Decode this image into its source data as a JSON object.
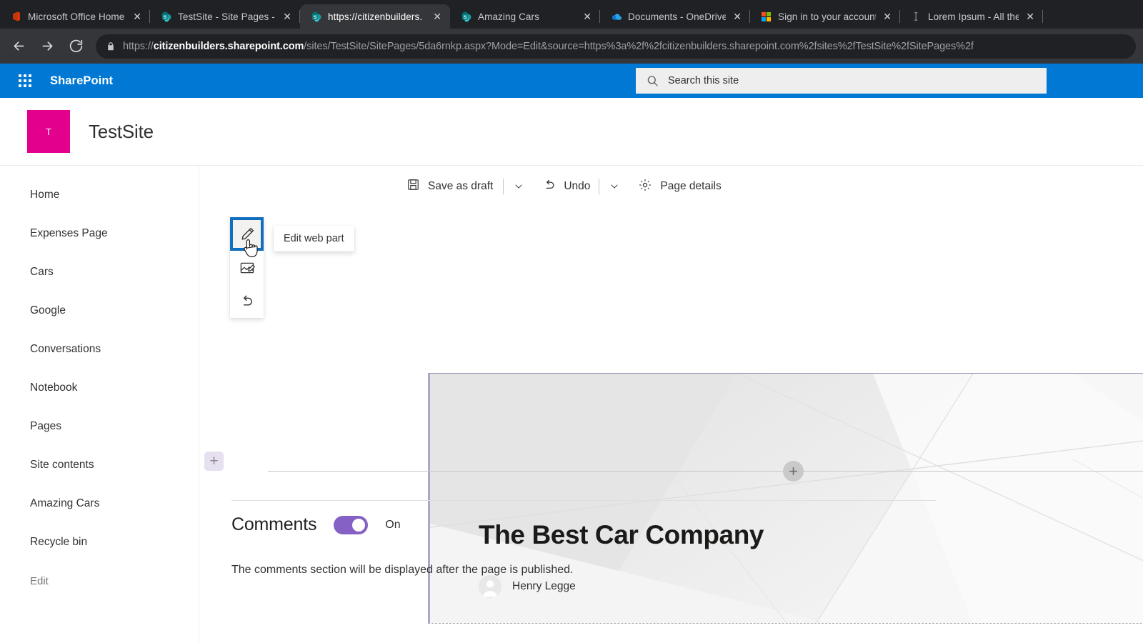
{
  "browser": {
    "tabs": [
      {
        "title": "Microsoft Office Home",
        "icon": "office-icon",
        "active": false,
        "close_label": "✕"
      },
      {
        "title": "TestSite - Site Pages -",
        "icon": "sharepoint-icon",
        "active": false,
        "close_label": "✕"
      },
      {
        "title": "https://citizenbuilders.",
        "icon": "sharepoint-icon",
        "active": true,
        "close_label": "✕"
      },
      {
        "title": "Amazing Cars",
        "icon": "sharepoint-icon",
        "active": false,
        "close_label": "✕"
      },
      {
        "title": "Documents - OneDrive",
        "icon": "onedrive-icon",
        "active": false,
        "close_label": "✕"
      },
      {
        "title": "Sign in to your account",
        "icon": "microsoft-icon",
        "active": false,
        "close_label": "✕"
      },
      {
        "title": "Lorem Ipsum - All the",
        "icon": "generic-icon",
        "active": false,
        "close_label": "✕"
      }
    ],
    "nav": {
      "back_label": "←",
      "forward_label": "→",
      "reload_label": "↻"
    },
    "url": {
      "scheme": "https://",
      "host": "citizenbuilders.sharepoint.com",
      "path": "/sites/TestSite/SitePages/5da6rnkp.aspx?Mode=Edit&source=https%3a%2f%2fcitizenbuilders.sharepoint.com%2fsites%2fTestSite%2fSitePages%2f"
    }
  },
  "suitebar": {
    "brand": "SharePoint",
    "waffle_label": "app-launcher"
  },
  "search": {
    "placeholder": "Search this site",
    "value": "Search this site"
  },
  "site": {
    "logo_letter": "T",
    "title": "TestSite"
  },
  "nav": {
    "items": [
      {
        "label": "Home"
      },
      {
        "label": "Expenses Page"
      },
      {
        "label": "Cars"
      },
      {
        "label": "Google"
      },
      {
        "label": "Conversations"
      },
      {
        "label": "Notebook"
      },
      {
        "label": "Pages"
      },
      {
        "label": "Site contents"
      },
      {
        "label": "Amazing Cars"
      },
      {
        "label": "Recycle bin"
      }
    ],
    "edit_label": "Edit"
  },
  "commandbar": {
    "save_label": "Save as draft",
    "save_chevron": "⌄",
    "undo_label": "Undo",
    "undo_chevron": "⌄",
    "page_details_label": "Page details"
  },
  "webpart_toolbar": {
    "edit_label": "edit-pencil",
    "image_label": "edit-image",
    "undo_label": "undo-arrow",
    "tooltip": "Edit web part"
  },
  "hero": {
    "title": "The Best Car Company",
    "author": "Henry Legge"
  },
  "canvas": {
    "add_section_label": "+",
    "add_webpart_label": "+"
  },
  "comments": {
    "label": "Comments",
    "toggle_state": "On",
    "note": "The comments section will be displayed after the page is published."
  },
  "colors": {
    "sharepoint_blue": "#0078d4",
    "site_logo_pink": "#e3008c",
    "toggle_purple": "#8661c5",
    "selection_blue": "#106ebe",
    "section_purple": "#b0a4cb"
  }
}
